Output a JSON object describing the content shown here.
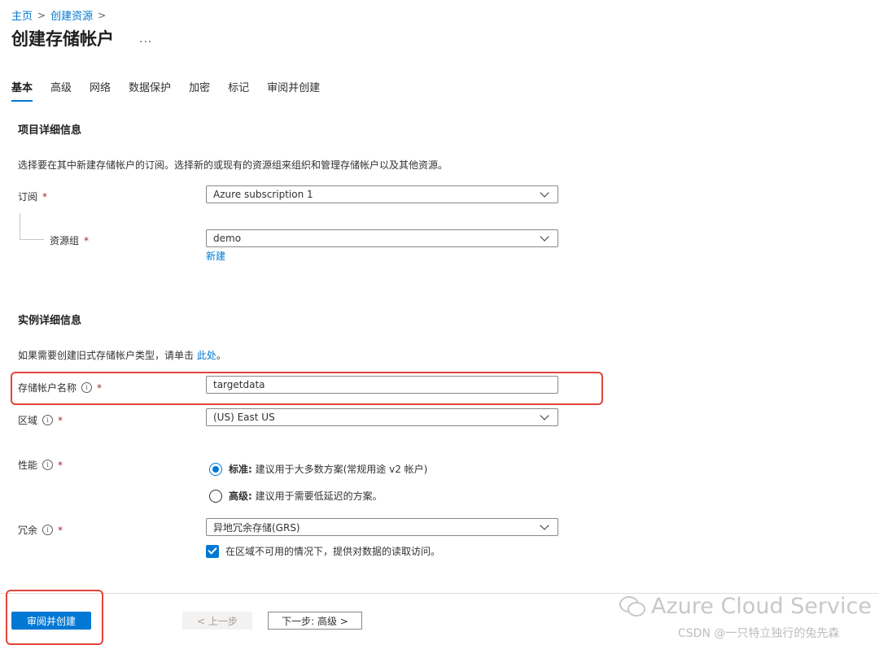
{
  "breadcrumb": {
    "home": "主页",
    "create": "创建资源",
    "sep": ">"
  },
  "page": {
    "title": "创建存储帐户",
    "more": "..."
  },
  "tabs": [
    "基本",
    "高级",
    "网络",
    "数据保护",
    "加密",
    "标记",
    "审阅并创建"
  ],
  "project": {
    "title": "项目详细信息",
    "desc": "选择要在其中新建存储帐户的订阅。选择新的或现有的资源组来组织和管理存储帐户以及其他资源。",
    "subscription_label": "订阅",
    "subscription_value": "Azure subscription 1",
    "resource_group_label": "资源组",
    "resource_group_value": "demo",
    "new_link": "新建"
  },
  "instance": {
    "title": "实例详细信息",
    "desc_prefix": "如果需要创建旧式存储帐户类型，请单击",
    "desc_link": "此处",
    "desc_suffix": "。",
    "name_label": "存储帐户名称",
    "name_value": "targetdata",
    "region_label": "区域",
    "region_value": "(US) East US",
    "perf_label": "性能",
    "perf_standard_bold": "标准:",
    "perf_standard_text": " 建议用于大多数方案(常规用途 v2 帐户)",
    "perf_premium_bold": "高级:",
    "perf_premium_text": " 建议用于需要低延迟的方案。",
    "redundancy_label": "冗余",
    "redundancy_value": "异地冗余存储(GRS)",
    "read_access_label": "在区域不可用的情况下，提供对数据的读取访问。"
  },
  "required_mark": "*",
  "info_glyph": "i",
  "footer": {
    "review": "审阅并创建",
    "prev": "< 上一步",
    "next": "下一步: 高级 >"
  },
  "watermark": {
    "line1": "Azure Cloud Service",
    "line2": "CSDN @一只特立独行的兔先森"
  },
  "colors": {
    "accent": "#0078d4",
    "highlight": "#e2453c",
    "required": "#a4262c"
  }
}
